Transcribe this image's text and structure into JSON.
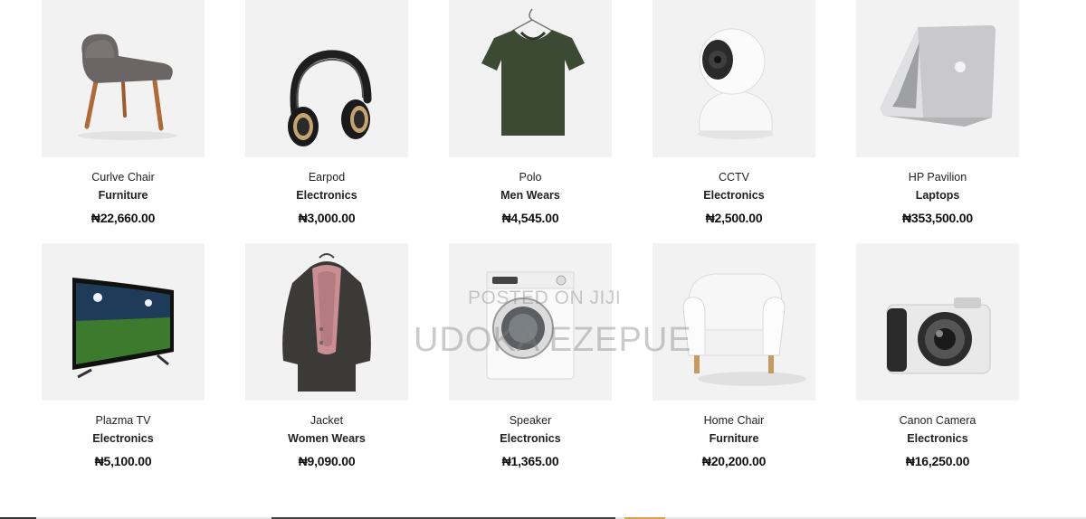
{
  "products": [
    {
      "name": "Curlve Chair",
      "category": "Furniture",
      "price": "₦22,660.00",
      "icon": "lounge-chair"
    },
    {
      "name": "Earpod",
      "category": "Electronics",
      "price": "₦3,000.00",
      "icon": "headphones"
    },
    {
      "name": "Polo",
      "category": "Men Wears",
      "price": "₦4,545.00",
      "icon": "t-shirt"
    },
    {
      "name": "CCTV",
      "category": "Electronics",
      "price": "₦2,500.00",
      "icon": "security-camera"
    },
    {
      "name": "HP Pavilion",
      "category": "Laptops",
      "price": "₦353,500.00",
      "icon": "laptop"
    },
    {
      "name": "Plazma TV",
      "category": "Electronics",
      "price": "₦5,100.00",
      "icon": "television"
    },
    {
      "name": "Jacket",
      "category": "Women Wears",
      "price": "₦9,090.00",
      "icon": "jacket"
    },
    {
      "name": "Speaker",
      "category": "Electronics",
      "price": "₦1,365.00",
      "icon": "washing-machine"
    },
    {
      "name": "Home Chair",
      "category": "Furniture",
      "price": "₦20,200.00",
      "icon": "armchair"
    },
    {
      "name": "Canon Camera",
      "category": "Electronics",
      "price": "₦16,250.00",
      "icon": "camera"
    }
  ],
  "watermark": {
    "line1": "POSTED ON JIJI",
    "line2": "UDOKA EZEPUE"
  },
  "colors": {
    "thumb_bg": "#f2f2f2",
    "text": "#222222"
  }
}
